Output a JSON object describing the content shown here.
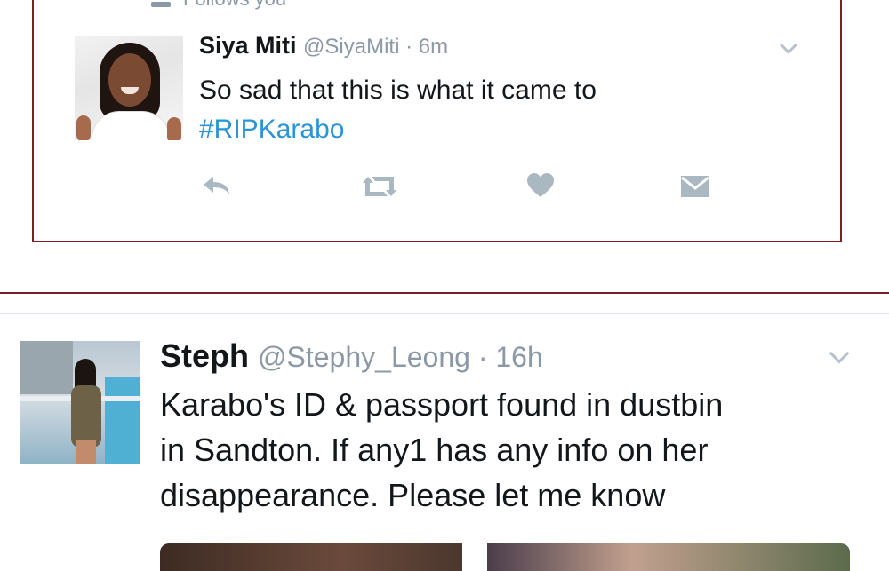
{
  "tweets": [
    {
      "context": "Follows you",
      "name": "Siya Miti",
      "handle": "@SiyaMiti",
      "time": "6m",
      "text_lines": [
        "So sad that this is what it came to"
      ],
      "hashtag": "#RIPKarabo"
    },
    {
      "name": "Steph",
      "handle": "@Stephy_Leong",
      "time": "16h",
      "text_lines": [
        "Karabo's ID & passport found in dustbin",
        "in Sandton. If any1 has any info on her",
        "disappearance. Please let me know"
      ]
    }
  ],
  "separator": " · ",
  "icons": {
    "follows": "person-icon",
    "menu": "chevron-down-icon",
    "reply": "reply-icon",
    "retweet": "retweet-icon",
    "like": "heart-icon",
    "dm": "envelope-icon"
  },
  "colors": {
    "frame_border": "#7a1f24",
    "hashtag": "#2a94d6",
    "muted": "#8b98a5",
    "action_icon": "#aab8c2",
    "divider": "#e1e8ed"
  }
}
